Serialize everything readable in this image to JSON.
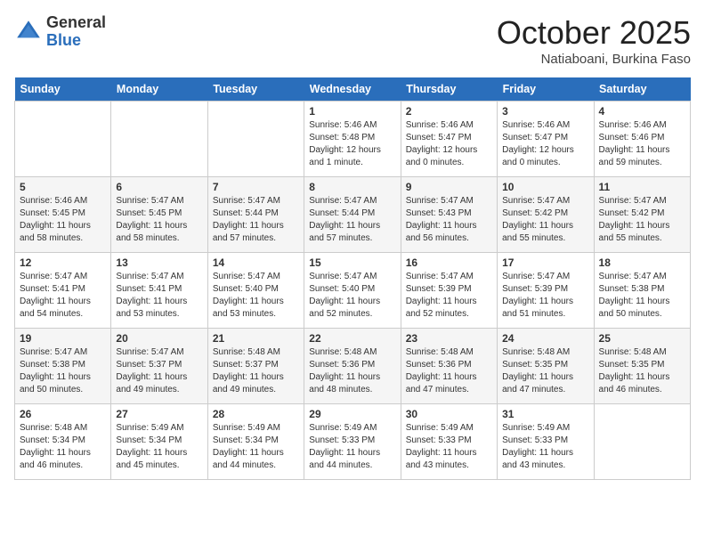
{
  "header": {
    "logo_general": "General",
    "logo_blue": "Blue",
    "month_title": "October 2025",
    "subtitle": "Natiaboani, Burkina Faso"
  },
  "days_of_week": [
    "Sunday",
    "Monday",
    "Tuesday",
    "Wednesday",
    "Thursday",
    "Friday",
    "Saturday"
  ],
  "weeks": [
    [
      {
        "day": "",
        "info": ""
      },
      {
        "day": "",
        "info": ""
      },
      {
        "day": "",
        "info": ""
      },
      {
        "day": "1",
        "info": "Sunrise: 5:46 AM\nSunset: 5:48 PM\nDaylight: 12 hours\nand 1 minute."
      },
      {
        "day": "2",
        "info": "Sunrise: 5:46 AM\nSunset: 5:47 PM\nDaylight: 12 hours\nand 0 minutes."
      },
      {
        "day": "3",
        "info": "Sunrise: 5:46 AM\nSunset: 5:47 PM\nDaylight: 12 hours\nand 0 minutes."
      },
      {
        "day": "4",
        "info": "Sunrise: 5:46 AM\nSunset: 5:46 PM\nDaylight: 11 hours\nand 59 minutes."
      }
    ],
    [
      {
        "day": "5",
        "info": "Sunrise: 5:46 AM\nSunset: 5:45 PM\nDaylight: 11 hours\nand 58 minutes."
      },
      {
        "day": "6",
        "info": "Sunrise: 5:47 AM\nSunset: 5:45 PM\nDaylight: 11 hours\nand 58 minutes."
      },
      {
        "day": "7",
        "info": "Sunrise: 5:47 AM\nSunset: 5:44 PM\nDaylight: 11 hours\nand 57 minutes."
      },
      {
        "day": "8",
        "info": "Sunrise: 5:47 AM\nSunset: 5:44 PM\nDaylight: 11 hours\nand 57 minutes."
      },
      {
        "day": "9",
        "info": "Sunrise: 5:47 AM\nSunset: 5:43 PM\nDaylight: 11 hours\nand 56 minutes."
      },
      {
        "day": "10",
        "info": "Sunrise: 5:47 AM\nSunset: 5:42 PM\nDaylight: 11 hours\nand 55 minutes."
      },
      {
        "day": "11",
        "info": "Sunrise: 5:47 AM\nSunset: 5:42 PM\nDaylight: 11 hours\nand 55 minutes."
      }
    ],
    [
      {
        "day": "12",
        "info": "Sunrise: 5:47 AM\nSunset: 5:41 PM\nDaylight: 11 hours\nand 54 minutes."
      },
      {
        "day": "13",
        "info": "Sunrise: 5:47 AM\nSunset: 5:41 PM\nDaylight: 11 hours\nand 53 minutes."
      },
      {
        "day": "14",
        "info": "Sunrise: 5:47 AM\nSunset: 5:40 PM\nDaylight: 11 hours\nand 53 minutes."
      },
      {
        "day": "15",
        "info": "Sunrise: 5:47 AM\nSunset: 5:40 PM\nDaylight: 11 hours\nand 52 minutes."
      },
      {
        "day": "16",
        "info": "Sunrise: 5:47 AM\nSunset: 5:39 PM\nDaylight: 11 hours\nand 52 minutes."
      },
      {
        "day": "17",
        "info": "Sunrise: 5:47 AM\nSunset: 5:39 PM\nDaylight: 11 hours\nand 51 minutes."
      },
      {
        "day": "18",
        "info": "Sunrise: 5:47 AM\nSunset: 5:38 PM\nDaylight: 11 hours\nand 50 minutes."
      }
    ],
    [
      {
        "day": "19",
        "info": "Sunrise: 5:47 AM\nSunset: 5:38 PM\nDaylight: 11 hours\nand 50 minutes."
      },
      {
        "day": "20",
        "info": "Sunrise: 5:47 AM\nSunset: 5:37 PM\nDaylight: 11 hours\nand 49 minutes."
      },
      {
        "day": "21",
        "info": "Sunrise: 5:48 AM\nSunset: 5:37 PM\nDaylight: 11 hours\nand 49 minutes."
      },
      {
        "day": "22",
        "info": "Sunrise: 5:48 AM\nSunset: 5:36 PM\nDaylight: 11 hours\nand 48 minutes."
      },
      {
        "day": "23",
        "info": "Sunrise: 5:48 AM\nSunset: 5:36 PM\nDaylight: 11 hours\nand 47 minutes."
      },
      {
        "day": "24",
        "info": "Sunrise: 5:48 AM\nSunset: 5:35 PM\nDaylight: 11 hours\nand 47 minutes."
      },
      {
        "day": "25",
        "info": "Sunrise: 5:48 AM\nSunset: 5:35 PM\nDaylight: 11 hours\nand 46 minutes."
      }
    ],
    [
      {
        "day": "26",
        "info": "Sunrise: 5:48 AM\nSunset: 5:34 PM\nDaylight: 11 hours\nand 46 minutes."
      },
      {
        "day": "27",
        "info": "Sunrise: 5:49 AM\nSunset: 5:34 PM\nDaylight: 11 hours\nand 45 minutes."
      },
      {
        "day": "28",
        "info": "Sunrise: 5:49 AM\nSunset: 5:34 PM\nDaylight: 11 hours\nand 44 minutes."
      },
      {
        "day": "29",
        "info": "Sunrise: 5:49 AM\nSunset: 5:33 PM\nDaylight: 11 hours\nand 44 minutes."
      },
      {
        "day": "30",
        "info": "Sunrise: 5:49 AM\nSunset: 5:33 PM\nDaylight: 11 hours\nand 43 minutes."
      },
      {
        "day": "31",
        "info": "Sunrise: 5:49 AM\nSunset: 5:33 PM\nDaylight: 11 hours\nand 43 minutes."
      },
      {
        "day": "",
        "info": ""
      }
    ]
  ]
}
